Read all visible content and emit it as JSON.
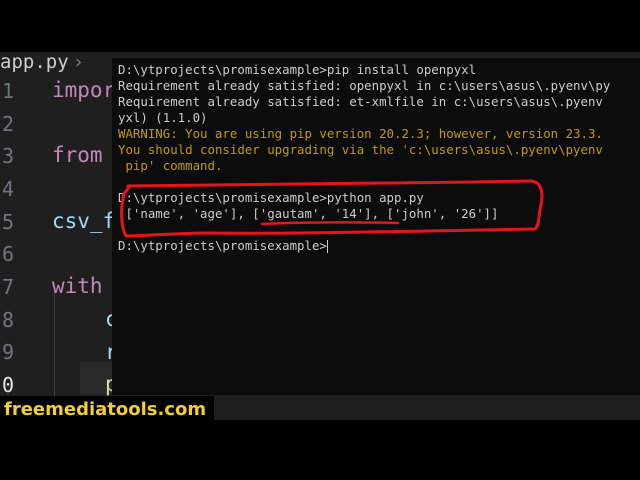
{
  "editor": {
    "tab_label": "app.py",
    "tab_separator": "›",
    "line_numbers": [
      "1",
      "2",
      "3",
      "4",
      "5",
      "6",
      "7",
      "8",
      "9",
      "0"
    ],
    "code": {
      "line1": "impor",
      "line3": "from",
      "line5": "csv_f",
      "line7": "with",
      "line8": "c",
      "line9": "r",
      "line10": "p"
    }
  },
  "terminal": {
    "lines": [
      "D:\\ytprojects\\promisexample>pip install openpyxl",
      "Requirement already satisfied: openpyxl in c:\\users\\asus\\.pyenv\\py",
      "Requirement already satisfied: et-xmlfile in c:\\users\\asus\\.pyenv",
      "yxl) (1.1.0)",
      "WARNING: You are using pip version 20.2.3; however, version 23.3.",
      "You should consider upgrading via the 'c:\\users\\asus\\.pyenv\\pyenv",
      " pip' command.",
      "",
      "D:\\ytprojects\\promisexample>python app.py",
      "[['name', 'age'], ['gautam', '14'], ['john', '26']]",
      "",
      "D:\\ytprojects\\promisexample>"
    ]
  },
  "watermark": "freemediatools.com",
  "colors": {
    "annotation": "#e8141c",
    "warning_text": "#c19c00",
    "watermark_text": "#f2d027"
  }
}
